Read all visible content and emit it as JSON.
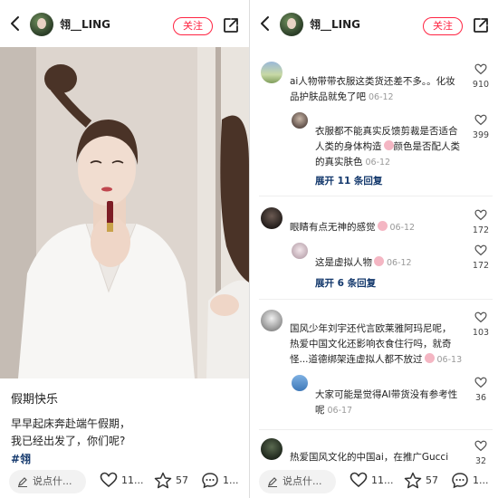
{
  "left": {
    "username": "翎__LING",
    "follow_label": "关注",
    "caption": {
      "title": "假期快乐",
      "line1": "早早起床奔赴端午假期，",
      "line2": "我已经出发了，你们呢?",
      "hashtag": "#翎"
    },
    "bottom": {
      "say_placeholder": "说点什...",
      "likes": "11...",
      "collects": "57",
      "comments": "1..."
    }
  },
  "right": {
    "username": "翎__LING",
    "follow_label": "关注",
    "comments": [
      {
        "text_a": "ai人物带带衣服这类货还差不多。。化妆",
        "text_b": "品护肤品就免了吧",
        "date": "06-12",
        "likes": "910"
      },
      {
        "text_a": "衣服都不能真实反馈剪裁是否适合",
        "text_b": "人类的身体构造",
        "text_c": "颜色是否配人类",
        "text_d": "的真实肤色",
        "date": "06-12",
        "likes": "399"
      },
      {
        "expand": "展开 11 条回复"
      },
      {
        "text_a": "眼睛有点无神的感觉",
        "date": "06-12",
        "likes": "172"
      },
      {
        "text_a": "这是虚拟人物",
        "date": "06-12",
        "likes": "172"
      },
      {
        "expand": "展开 6 条回复"
      },
      {
        "text_a": "国风少年刘宇还代言欧莱雅阿玛尼呢，",
        "text_b": "热爱中国文化还影响衣食住行吗，就奇",
        "text_c": "怪...道德绑架连虚拟人都不放过",
        "date": "06-13",
        "likes": "103"
      },
      {
        "text_a": "大家可能是觉得AI带货没有参考性",
        "text_b": "呢",
        "date": "06-17",
        "likes": "36"
      },
      {
        "text_a": "热爱国风文化的中国ai，在推广Gucci",
        "likes": "32"
      }
    ],
    "bottom": {
      "say_placeholder": "说点什...",
      "likes": "11...",
      "collects": "57",
      "comments": "1..."
    }
  }
}
